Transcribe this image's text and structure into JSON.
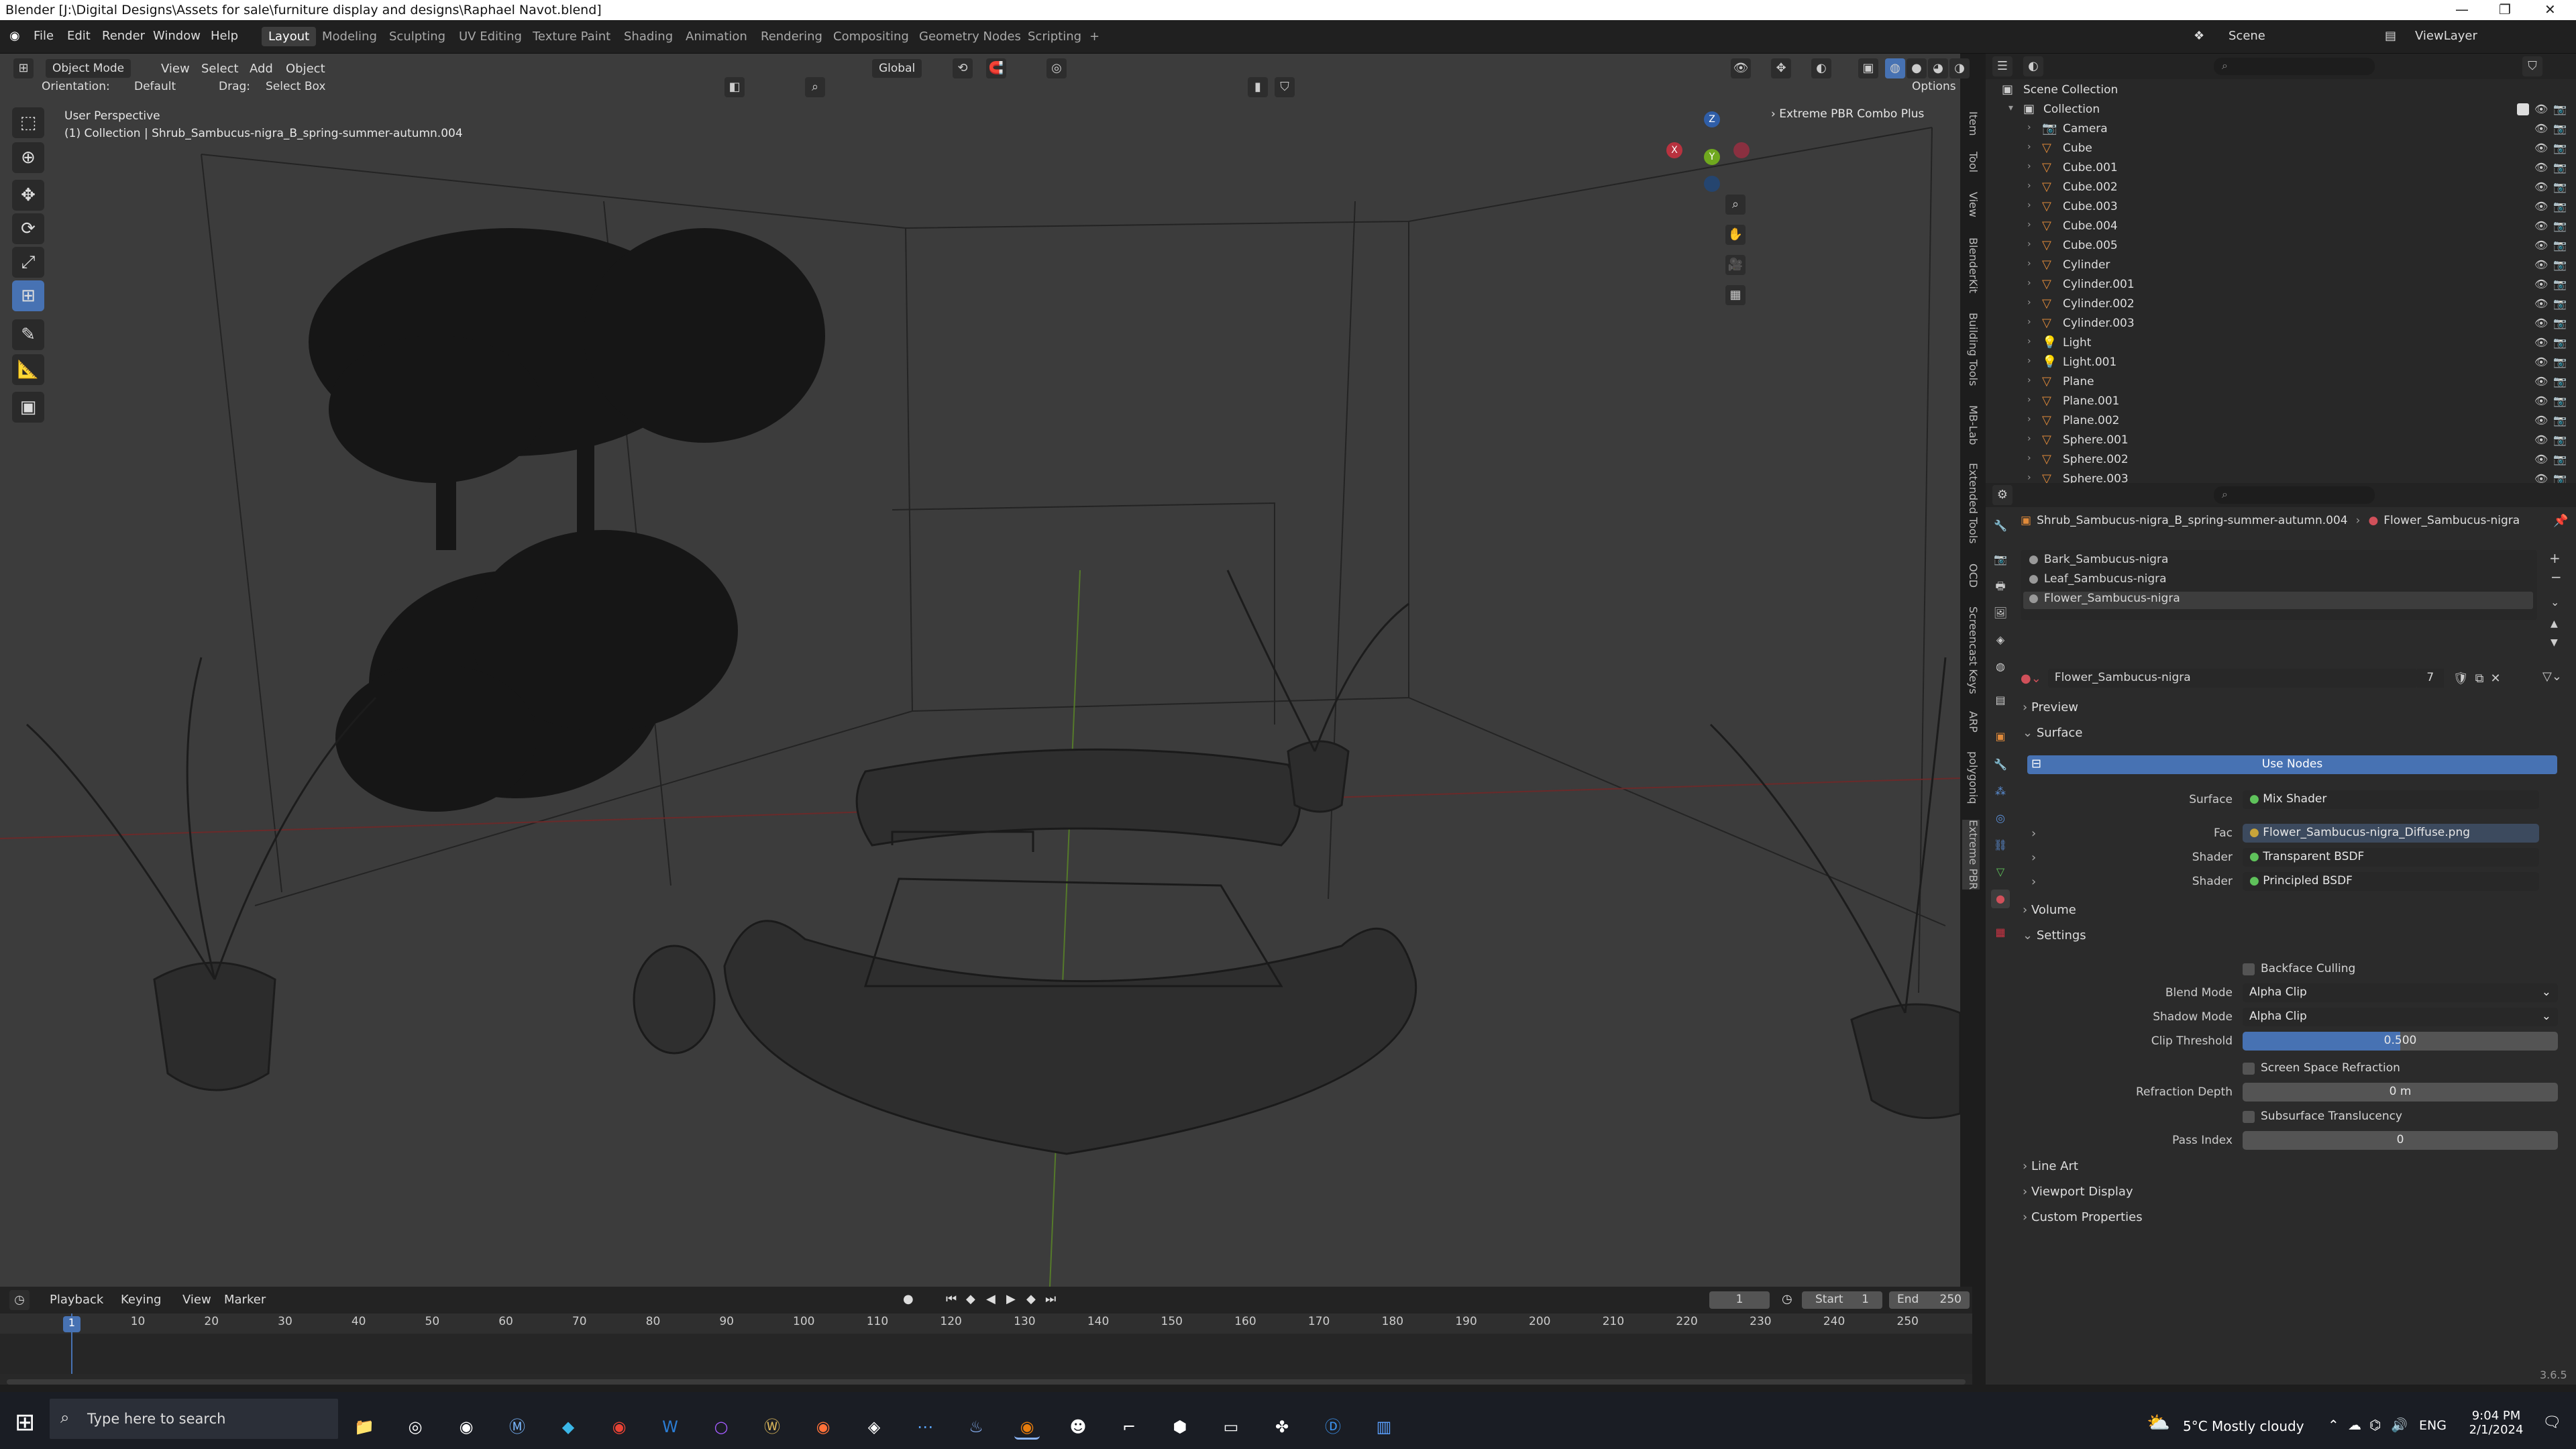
{
  "title_bar": {
    "title": "Blender [J:\\Digital Designs\\Assets for sale\\furniture display and designs\\Raphael Navot.blend]"
  },
  "menubar": {
    "menus": [
      "File",
      "Edit",
      "Render",
      "Window",
      "Help"
    ],
    "workspaces": [
      "Layout",
      "Modeling",
      "Sculpting",
      "UV Editing",
      "Texture Paint",
      "Shading",
      "Animation",
      "Rendering",
      "Compositing",
      "Geometry Nodes",
      "Scripting"
    ],
    "active_workspace": "Layout",
    "add_tab": "+",
    "scene": "Scene",
    "view_layer": "ViewLayer"
  },
  "viewport_header": {
    "mode": "Object Mode",
    "menus": [
      "View",
      "Select",
      "Add",
      "Object"
    ],
    "transform_orientation": "Global",
    "orientation_label": "Orientation:",
    "orientation_value": "Default",
    "drag_label": "Drag:",
    "drag_value": "Select Box",
    "options": "Options"
  },
  "viewport": {
    "perspective": "User Perspective",
    "collection_info": "(1) Collection | Shrub_Sambucus-nigra_B_spring-summer-autumn.004",
    "addon_panel": "Extreme PBR Combo Plus",
    "gizmo": {
      "x": "X",
      "y": "Y",
      "z": "Z"
    },
    "side_tabs": [
      "Item",
      "Tool",
      "View",
      "BlenderKit",
      "Building Tools",
      "MB-Lab",
      "Extended Tools",
      "OCD",
      "Screencast Keys",
      "ARP",
      "polygoniq",
      "Extreme PBR"
    ]
  },
  "outliner": {
    "root": "Scene Collection",
    "collection": "Collection",
    "items": [
      "Camera",
      "Cube",
      "Cube.001",
      "Cube.002",
      "Cube.003",
      "Cube.004",
      "Cube.005",
      "Cylinder",
      "Cylinder.001",
      "Cylinder.002",
      "Cylinder.003",
      "Light",
      "Light.001",
      "Plane",
      "Plane.001",
      "Plane.002",
      "Sphere.001",
      "Sphere.002",
      "Sphere.003"
    ]
  },
  "properties": {
    "breadcrumb_object": "Shrub_Sambucus-nigra_B_spring-summer-autumn.004",
    "breadcrumb_material": "Flower_Sambucus-nigra",
    "material_slots": [
      "Bark_Sambucus-nigra",
      "Leaf_Sambucus-nigra",
      "Flower_Sambucus-nigra"
    ],
    "active_material": "Flower_Sambucus-nigra",
    "user_count": "7",
    "panels": {
      "preview": "Preview",
      "surface": "Surface",
      "use_nodes": "Use Nodes",
      "volume": "Volume",
      "settings": "Settings",
      "line_art": "Line Art",
      "viewport_display": "Viewport Display",
      "custom_properties": "Custom Properties"
    },
    "surface": {
      "surface_label": "Surface",
      "surface_value": "Mix Shader",
      "fac_label": "Fac",
      "fac_value": "Flower_Sambucus-nigra_Diffuse.png",
      "shader1_label": "Shader",
      "shader1_value": "Transparent BSDF",
      "shader2_label": "Shader",
      "shader2_value": "Principled BSDF"
    },
    "settings": {
      "backface_culling": "Backface Culling",
      "blend_mode_label": "Blend Mode",
      "blend_mode": "Alpha Clip",
      "shadow_mode_label": "Shadow Mode",
      "shadow_mode": "Alpha Clip",
      "clip_threshold_label": "Clip Threshold",
      "clip_threshold": "0.500",
      "clip_threshold_fraction": 0.5,
      "screen_space_refraction": "Screen Space Refraction",
      "refraction_depth_label": "Refraction Depth",
      "refraction_depth": "0 m",
      "subsurface_translucency": "Subsurface Translucency",
      "pass_index_label": "Pass Index",
      "pass_index": "0"
    }
  },
  "timeline": {
    "menus": [
      "Playback",
      "Keying",
      "View",
      "Marker"
    ],
    "current_frame": "1",
    "start_label": "Start",
    "start": "1",
    "end_label": "End",
    "end": "250",
    "ruler": [
      "10",
      "20",
      "30",
      "40",
      "50",
      "60",
      "70",
      "80",
      "90",
      "100",
      "110",
      "120",
      "130",
      "140",
      "150",
      "160",
      "170",
      "180",
      "190",
      "200",
      "210",
      "220",
      "230",
      "240",
      "250"
    ],
    "playhead_label": "1"
  },
  "status": {
    "version": "3.6.5"
  },
  "taskbar": {
    "search_placeholder": "Type here to search",
    "weather": "5°C  Mostly cloudy",
    "language": "ENG",
    "time": "9:04 PM",
    "date": "2/1/2024"
  }
}
